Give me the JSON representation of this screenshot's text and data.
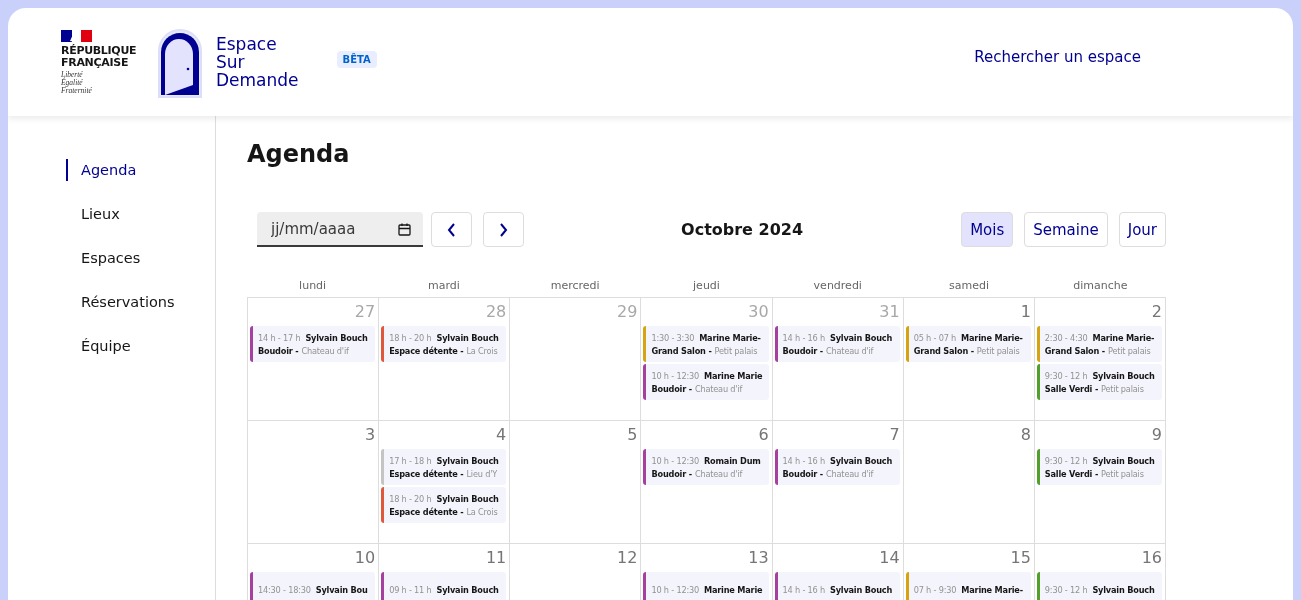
{
  "header": {
    "republic": {
      "name_lines": [
        "RÉPUBLIQUE",
        "FRANÇAISE"
      ],
      "motto": [
        "Liberté",
        "Égalité",
        "Fraternité"
      ]
    },
    "brand_lines": [
      "Espace",
      "Sur",
      "Demande"
    ],
    "badge": "BÊTA",
    "search_link": "Rechercher un espace"
  },
  "sidebar": {
    "items": [
      {
        "label": "Agenda",
        "selected": true
      },
      {
        "label": "Lieux",
        "selected": false
      },
      {
        "label": "Espaces",
        "selected": false
      },
      {
        "label": "Réservations",
        "selected": false
      },
      {
        "label": "Équipe",
        "selected": false
      }
    ]
  },
  "page_title": "Agenda",
  "toolbar": {
    "date_field": {
      "placeholder": "jj/mm/aaaa"
    },
    "month_label": "Octobre 2024",
    "views": [
      {
        "label": "Mois",
        "selected": true
      },
      {
        "label": "Semaine",
        "selected": false
      },
      {
        "label": "Jour",
        "selected": false
      }
    ]
  },
  "calendar": {
    "weekdays": [
      "lundi",
      "mardi",
      "mercredi",
      "jeudi",
      "vendredi",
      "samedi",
      "dimanche"
    ],
    "weeks": [
      {
        "days": [
          {
            "day": "27",
            "outside_month": true,
            "events": [
              {
                "time": "14 h - 17 h",
                "person": "Sylvain Bouch",
                "space": "Boudoir -",
                "place": "Chateau d'if",
                "color": "#a6409f"
              }
            ]
          },
          {
            "day": "28",
            "outside_month": true,
            "events": [
              {
                "time": "18 h - 20 h",
                "person": "Sylvain Bouch",
                "space": "Espace détente -",
                "place": "La Crois",
                "color": "#e0583b"
              }
            ]
          },
          {
            "day": "29",
            "outside_month": true
          },
          {
            "day": "30",
            "outside_month": true,
            "events": [
              {
                "time": "1:30 - 3:30",
                "person": "Marine Marie-",
                "space": "Grand Salon -",
                "place": "Petit palais",
                "color": "#d6a412"
              },
              {
                "time": "10 h - 12:30",
                "person": "Marine Marie",
                "space": "Boudoir -",
                "place": "Chateau d'if",
                "color": "#a6409f"
              }
            ]
          },
          {
            "day": "31",
            "outside_month": true,
            "events": [
              {
                "time": "14 h - 16 h",
                "person": "Sylvain Bouch",
                "space": "Boudoir -",
                "place": "Chateau d'if",
                "color": "#a6409f"
              }
            ]
          },
          {
            "day": "1",
            "outside_month": false,
            "events": [
              {
                "time": "05 h - 07 h",
                "person": "Marine Marie-",
                "space": "Grand Salon -",
                "place": "Petit palais",
                "color": "#d6a412"
              }
            ]
          },
          {
            "day": "2",
            "outside_month": false,
            "events": [
              {
                "time": "2:30 - 4:30",
                "person": "Marine Marie-",
                "space": "Grand Salon -",
                "place": "Petit palais",
                "color": "#d6a412"
              },
              {
                "time": "9:30 - 12 h",
                "person": "Sylvain Bouch",
                "space": "Salle Verdi -",
                "place": "Petit palais",
                "color": "#52a02a"
              }
            ]
          }
        ]
      },
      {
        "days": [
          {
            "day": "3",
            "outside_month": false
          },
          {
            "day": "4",
            "outside_month": false,
            "events": [
              {
                "time": "17 h - 18 h",
                "person": "Sylvain Bouch",
                "space": "Espace détente -",
                "place": "Lieu d'Y",
                "color": "#c4c4c4"
              },
              {
                "time": "18 h - 20 h",
                "person": "Sylvain Bouch",
                "space": "Espace détente -",
                "place": "La Crois",
                "color": "#e0583b"
              }
            ]
          },
          {
            "day": "5",
            "outside_month": false
          },
          {
            "day": "6",
            "outside_month": false,
            "events": [
              {
                "time": "10 h - 12:30",
                "person": "Romain Dum",
                "space": "Boudoir -",
                "place": "Chateau d'if",
                "color": "#a6409f"
              }
            ]
          },
          {
            "day": "7",
            "outside_month": false,
            "events": [
              {
                "time": "14 h - 16 h",
                "person": "Sylvain Bouch",
                "space": "Boudoir -",
                "place": "Chateau d'if",
                "color": "#a6409f"
              }
            ]
          },
          {
            "day": "8",
            "outside_month": false
          },
          {
            "day": "9",
            "outside_month": false,
            "events": [
              {
                "time": "9:30 - 12 h",
                "person": "Sylvain Bouch",
                "space": "Salle Verdi -",
                "place": "Petit palais",
                "color": "#52a02a"
              }
            ]
          }
        ]
      },
      {
        "days": [
          {
            "day": "10",
            "outside_month": false,
            "events": [
              {
                "time": "14:30 - 18:30",
                "person": "Sylvain Bou",
                "color": "#a6409f"
              }
            ]
          },
          {
            "day": "11",
            "outside_month": false,
            "events": [
              {
                "time": "09 h - 11 h",
                "person": "Sylvain Bouch",
                "color": "#a6409f"
              }
            ]
          },
          {
            "day": "12",
            "outside_month": false
          },
          {
            "day": "13",
            "outside_month": false,
            "events": [
              {
                "time": "10 h - 12:30",
                "person": "Marine Marie",
                "color": "#a6409f"
              }
            ]
          },
          {
            "day": "14",
            "outside_month": false,
            "events": [
              {
                "time": "14 h - 16 h",
                "person": "Sylvain Bouch",
                "color": "#a6409f"
              }
            ]
          },
          {
            "day": "15",
            "outside_month": false,
            "events": [
              {
                "time": "07 h - 9:30",
                "person": "Marine Marie-",
                "color": "#d6a412"
              }
            ]
          },
          {
            "day": "16",
            "outside_month": false,
            "events": [
              {
                "time": "9:30 - 12 h",
                "person": "Sylvain Bouch",
                "color": "#52a02a"
              }
            ]
          }
        ]
      }
    ]
  }
}
